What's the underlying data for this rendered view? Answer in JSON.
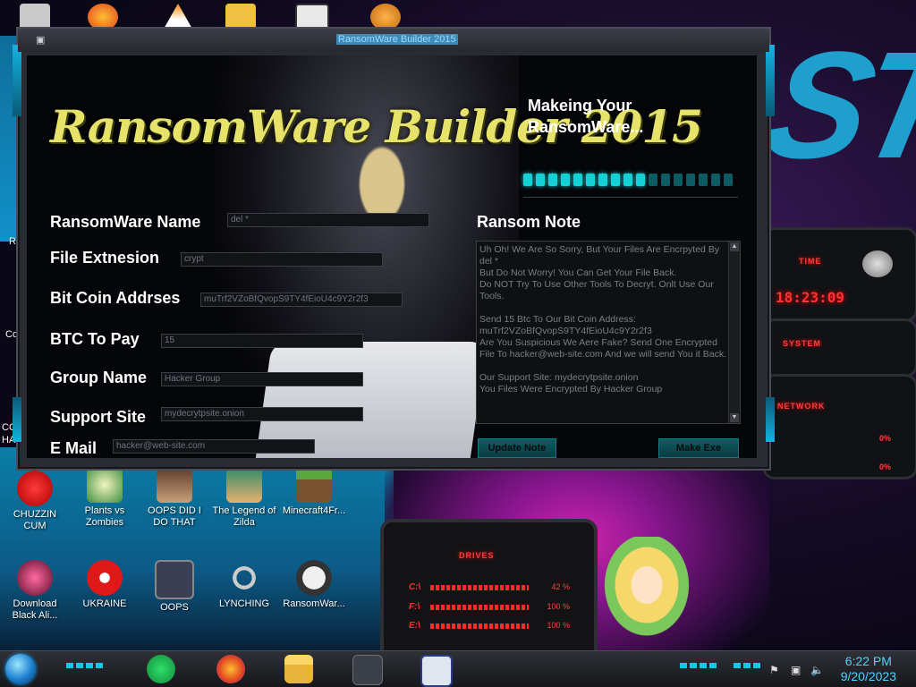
{
  "window": {
    "title": "RansomWare Builder 2015",
    "logo": "RansomWare Builder 2015",
    "status": "Makeing Your RansomWare...",
    "progress": 0.6
  },
  "form": {
    "name": {
      "label": "RansomWare Name",
      "value": "del *"
    },
    "ext": {
      "label": "File Extnesion",
      "value": "crypt"
    },
    "btc": {
      "label": "Bit Coin Addrses",
      "value": "muTrf2VZoBfQvopS9TY4fEioU4c9Y2r2f3"
    },
    "pay": {
      "label": "BTC To Pay",
      "value": "15"
    },
    "group": {
      "label": "Group Name",
      "value": "Hacker Group"
    },
    "site": {
      "label": "Support Site",
      "value": "mydecrytpsite.onion"
    },
    "email": {
      "label": "E Mail",
      "value": "hacker@web-site.com"
    }
  },
  "note": {
    "title": "Ransom Note",
    "text": "Uh Oh! We Are So Sorry, But Your Files Are Encrpyted By del *\nBut Do Not Worry! You Can Get Your File Back.\nDo NOT Try To Use Other Tools To Decryt. Onlt Use Our Tools.\n\nSend 15 Btc To Our Bit Coin Address:\nmuTrf2VZoBfQvopS9TY4fEioU4c9Y2r2f3\nAre You Suspicious We Aere Fake? Send One Encrypted File To hacker@web-site.com And we will send You it Back.\n\nOur Support Site: mydecrytpsite.onion\nYou Files Were Encrypted By Hacker Group",
    "update_label": "Update Note",
    "make_label": "Make Exe"
  },
  "widgets": {
    "time_tag": "TIME",
    "time": "18:23:09",
    "system_tag": "SYSTEM",
    "network_tag": "NETWORK",
    "net_pct_1": "0%",
    "net_pct_2": "0%",
    "drives_tag": "DRIVES",
    "drives": [
      {
        "letter": "C:\\",
        "pct": "42 %"
      },
      {
        "letter": "F:\\",
        "pct": "100 %"
      },
      {
        "letter": "E:\\",
        "pct": "100 %"
      }
    ]
  },
  "edge_labels": {
    "re": "Re",
    "co": "Co",
    "co2": "CO",
    "ha": "HA"
  },
  "desktop_icons": [
    {
      "label": "CHUZZIN CUM"
    },
    {
      "label": "Plants vs Zombies"
    },
    {
      "label": "OOPS DID I DO THAT"
    },
    {
      "label": "The Legend of Zilda"
    },
    {
      "label": "Minecraft4Fr..."
    },
    {
      "label": "Download Black Ali..."
    },
    {
      "label": "UKRAINE"
    },
    {
      "label": "OOPS"
    },
    {
      "label": "LYNCHING"
    },
    {
      "label": "RansomWar..."
    }
  ],
  "clock": {
    "time": "6:22 PM",
    "date": "9/20/2023"
  },
  "colors": {
    "accent": "#15d0d4",
    "widget_red": "#ff3333",
    "clock_blue": "#4fd3ff"
  }
}
